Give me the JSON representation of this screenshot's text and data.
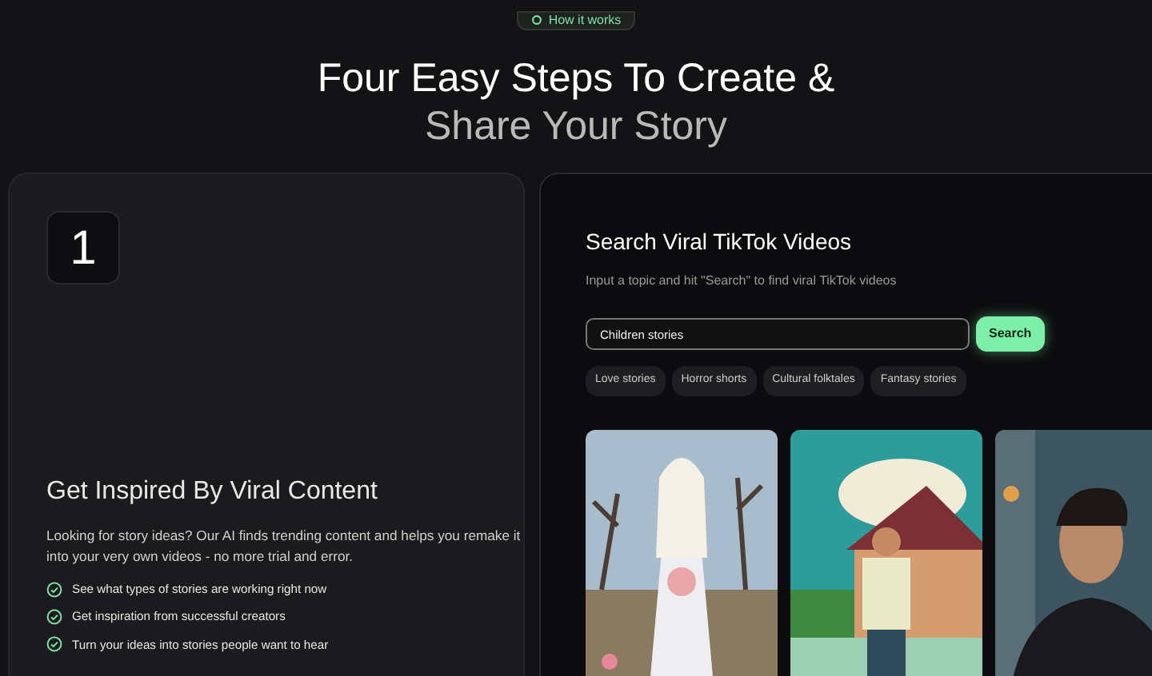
{
  "badge": {
    "label": "How it works"
  },
  "heading": {
    "line_1": "Four Easy Steps To Create &",
    "line_2": "Share Your Story"
  },
  "step_card": {
    "number": "1",
    "title": "Get Inspired By Viral Content",
    "description": "Looking for story ideas? Our AI finds trending content and helps you remake it into your very own videos - no more trial and error.",
    "features": [
      "See what types of stories are working right now",
      "Get inspiration from successful creators",
      "Turn your ideas into stories people want to hear"
    ]
  },
  "demo": {
    "title": "Search Viral TikTok Videos",
    "subtitle": "Input a topic and hit \"Search\" to find viral TikTok videos",
    "search": {
      "value": "Children stories"
    },
    "search_button": "Search",
    "suggestions": [
      "Love stories",
      "Horror shorts",
      "Cultural folktales",
      "Fantasy stories"
    ]
  }
}
